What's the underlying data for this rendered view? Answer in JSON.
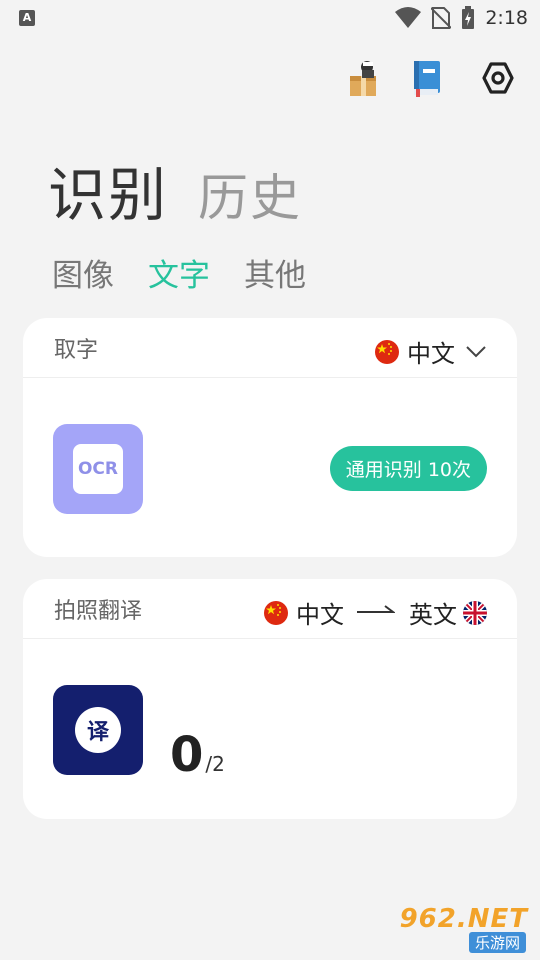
{
  "status_bar": {
    "time": "2:18",
    "notification_letter": "A"
  },
  "toolbar": {
    "icons": [
      "store-icon",
      "book-icon",
      "settings-icon"
    ]
  },
  "header": {
    "title": "识别",
    "secondary_tab": "历史"
  },
  "tabs": [
    {
      "label": "图像",
      "active": false
    },
    {
      "label": "文字",
      "active": true
    },
    {
      "label": "其他",
      "active": false
    }
  ],
  "ocr_card": {
    "title": "取字",
    "language": "中文",
    "tile_label": "OCR",
    "badge": "通用识别 10次"
  },
  "translate_card": {
    "title": "拍照翻译",
    "source_language": "中文",
    "target_language": "英文",
    "tile_label": "译",
    "count": "0",
    "count_total": "/2"
  },
  "watermark": {
    "top": "962.NET",
    "bottom": "乐游网"
  },
  "colors": {
    "accent": "#27c29d",
    "ocr_tile": "#a4a5f8",
    "translate_tile": "#141f6e",
    "background": "#f3f3f3"
  }
}
